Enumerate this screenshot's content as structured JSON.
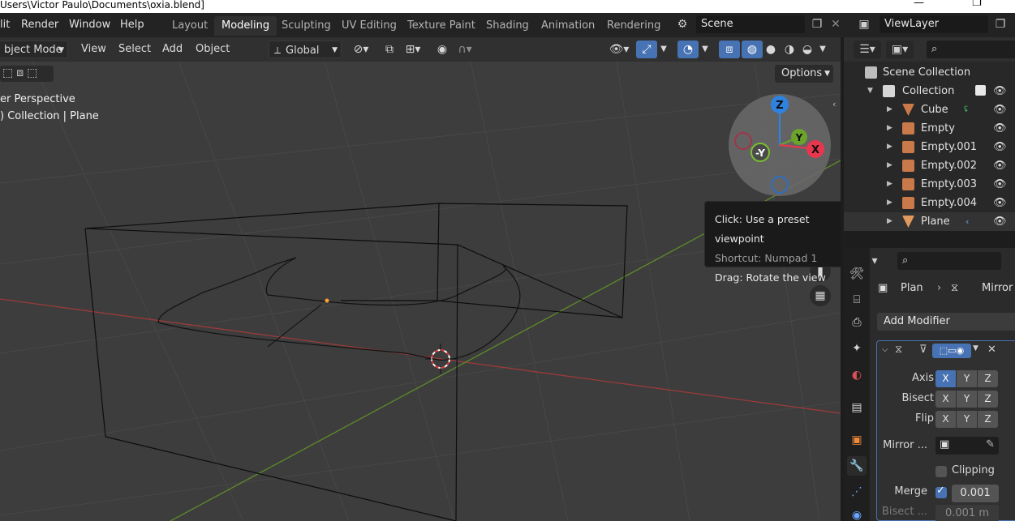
{
  "window": {
    "title": "Users\\Victor Paulo\\Documents\\oxia.blend]",
    "minimize_glyph": "—",
    "maximize_glyph": "❐"
  },
  "menu": [
    "lit",
    "Render",
    "Window",
    "Help"
  ],
  "workspaces": {
    "active": "Modeling",
    "tabs": [
      "Layout",
      "Modeling",
      "Sculpting",
      "UV Editing",
      "Texture Paint",
      "Shading",
      "Animation",
      "Rendering"
    ]
  },
  "scene": {
    "label": "Scene"
  },
  "view_layer": {
    "label": "ViewLayer"
  },
  "viewport_header": {
    "mode": "bject Mode",
    "menus": [
      "View",
      "Select",
      "Add",
      "Object"
    ],
    "orientation": "Global"
  },
  "viewport": {
    "info_line1": "er Perspective",
    "info_line2": ") Collection | Plane",
    "options_label": "Options",
    "gizmo": {
      "z": "Z",
      "y": "Y",
      "x": "X",
      "neg_y": "-Y"
    }
  },
  "tooltip": {
    "main": "Click: Use a preset viewpoint",
    "shortcut": "Shortcut: Numpad 1",
    "drag": "Drag: Rotate the view"
  },
  "outliner": {
    "scene_collection": "Scene Collection",
    "collection": "Collection",
    "items": [
      {
        "label": "Cube",
        "type": "mesh"
      },
      {
        "label": "Empty",
        "type": "empty"
      },
      {
        "label": "Empty.001",
        "type": "empty"
      },
      {
        "label": "Empty.002",
        "type": "empty"
      },
      {
        "label": "Empty.003",
        "type": "empty"
      },
      {
        "label": "Empty.004",
        "type": "empty"
      },
      {
        "label": "Plane",
        "type": "mesh"
      }
    ]
  },
  "properties": {
    "breadcrumb_object": "Plan",
    "breadcrumb_modifier": "Mirror",
    "add_modifier": "Add Modifier",
    "axis_label": "Axis",
    "bisect_label": "Bisect",
    "flip_label": "Flip",
    "mirror_object_label": "Mirror ...",
    "clipping_label": "Clipping",
    "merge_label": "Merge",
    "merge_value": "0.001",
    "bisect_dist_label": "Bisect ...",
    "bisect_dist_value": "0.001 m",
    "axes": [
      "X",
      "Y",
      "Z"
    ]
  },
  "colors": {
    "accent": "#4772b3",
    "axis_x": "#e8364f",
    "axis_y": "#6ba32b",
    "axis_z": "#2f83e0",
    "object_orange": "#c9794a"
  }
}
